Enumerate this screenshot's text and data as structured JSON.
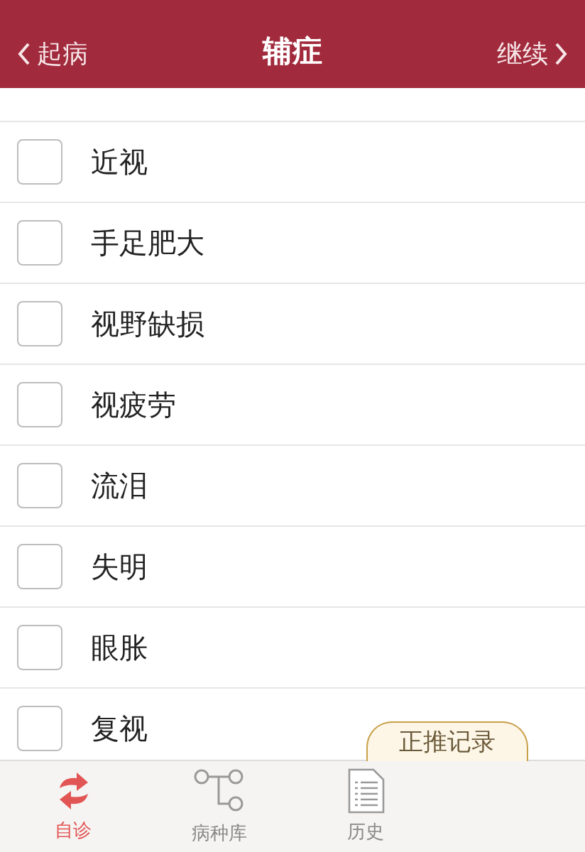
{
  "header": {
    "back": "起病",
    "title": "辅症",
    "next": "继续"
  },
  "symptoms": [
    {
      "label": "近视",
      "checked": false
    },
    {
      "label": "手足肥大",
      "checked": false
    },
    {
      "label": "视野缺损",
      "checked": false
    },
    {
      "label": "视疲劳",
      "checked": false
    },
    {
      "label": "流泪",
      "checked": false
    },
    {
      "label": "失明",
      "checked": false
    },
    {
      "label": "眼胀",
      "checked": false
    },
    {
      "label": "复视",
      "checked": false
    }
  ],
  "record_tab": "正推记录",
  "tabs": [
    {
      "kind": "diagnose",
      "label": "自诊",
      "selected": true
    },
    {
      "kind": "library",
      "label": "病种库",
      "selected": false
    },
    {
      "kind": "history",
      "label": "历史",
      "selected": false
    }
  ]
}
